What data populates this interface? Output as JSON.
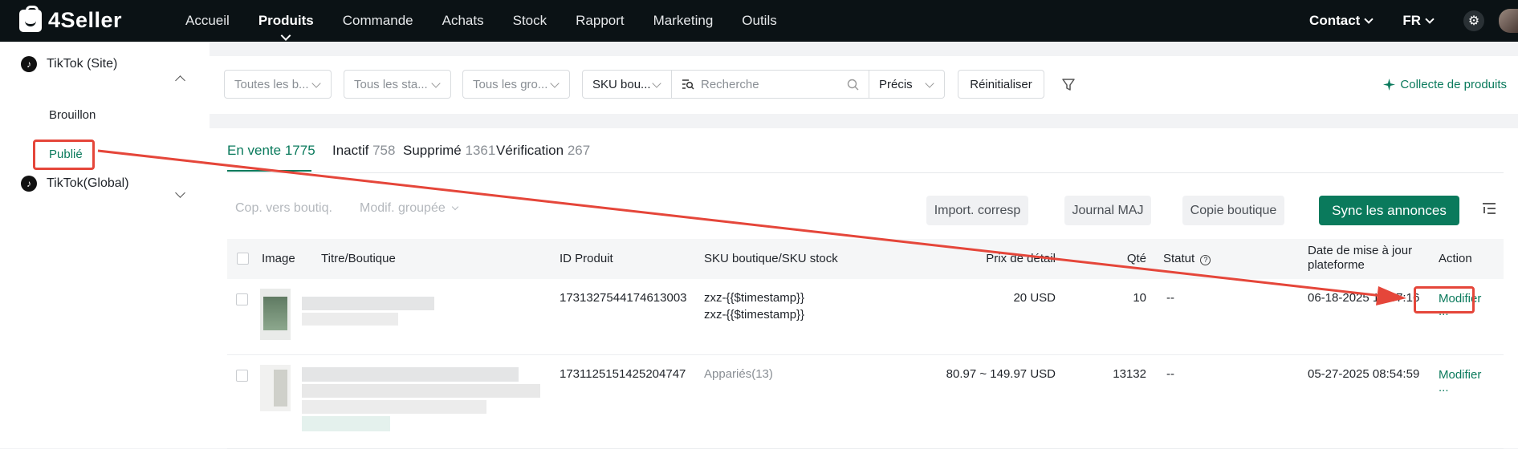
{
  "app": {
    "logo_text": "4Seller"
  },
  "nav": {
    "items": [
      "Accueil",
      "Produits",
      "Commande",
      "Achats",
      "Stock",
      "Rapport",
      "Marketing",
      "Outils"
    ],
    "active": "Produits",
    "contact": "Contact",
    "language": "FR"
  },
  "sidebar": {
    "group1": {
      "label": "TikTok (Site)",
      "items": [
        "Brouillon",
        "Publié"
      ],
      "active": "Publié"
    },
    "group2": {
      "label": "TikTok(Global)"
    }
  },
  "filters": {
    "stores": "Toutes les b...",
    "status": "Tous les sta...",
    "groups": "Tous les gro...",
    "field": "SKU bou...",
    "search_placeholder": "Recherche",
    "match": "Précis",
    "reset": "Réinitialiser",
    "collect": "Collecte de produits"
  },
  "tabs": [
    {
      "label": "En vente",
      "count": "1775"
    },
    {
      "label": "Inactif",
      "count": "758"
    },
    {
      "label": "Supprimé",
      "count": "1361"
    },
    {
      "label": "Vérification",
      "count": "267"
    }
  ],
  "actions": {
    "copy_to_store": "Cop. vers boutiq.",
    "bulk_edit": "Modif. groupée",
    "import": "Import. corresp",
    "journal": "Journal MAJ",
    "copy_store": "Copie boutique",
    "sync": "Sync les annonces"
  },
  "table": {
    "headers": {
      "image": "Image",
      "title": "Titre/Boutique",
      "product_id": "ID Produit",
      "sku": "SKU boutique/SKU stock",
      "price": "Prix de détail",
      "qty": "Qté",
      "status": "Statut",
      "updated_line1": "Date de mise à jour",
      "updated_line2": "plateforme",
      "action": "Action"
    },
    "rows": [
      {
        "product_id": "1731327544174613003",
        "sku_line1": "zxz-{{$timestamp}}",
        "sku_line2": "zxz-{{$timestamp}}",
        "price": "20 USD",
        "qty": "10",
        "status": "--",
        "updated": "06-18-2025 18:57:16",
        "action": "Modifier",
        "more": "..."
      },
      {
        "product_id": "1731125151425204747",
        "sku_label": "Appariés",
        "sku_count": "(13)",
        "price": "80.97 ~ 149.97 USD",
        "qty": "13132",
        "status": "--",
        "updated": "05-27-2025 08:54:59",
        "action": "Modifier",
        "more": "..."
      }
    ]
  },
  "colors": {
    "accent": "#0a7a5c",
    "topbar": "#0b1215",
    "annotation": "#e5463a"
  }
}
